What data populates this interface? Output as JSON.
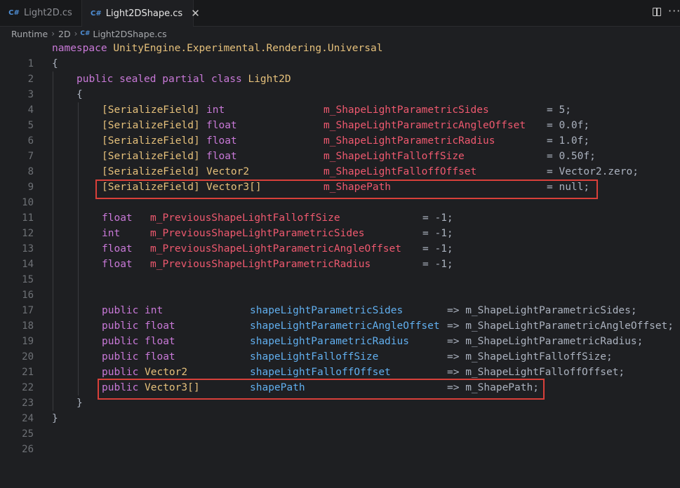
{
  "tabs": [
    {
      "label": "Light2D.cs",
      "icon": "csharp-file-icon",
      "active": false
    },
    {
      "label": "Light2DShape.cs",
      "icon": "csharp-file-icon",
      "active": true
    }
  ],
  "toolbar": {
    "split_icon": "split-editor-icon",
    "more_icon": "more-actions-icon",
    "more_label": "···",
    "close_label": "✕"
  },
  "breadcrumb": {
    "items": [
      "Runtime",
      "2D",
      "Light2DShape.cs"
    ],
    "separator": "›",
    "icon_label": "C#"
  },
  "colors": {
    "highlight_box": "#d8403a",
    "keyword": "#c979d8",
    "type": "#e5c07b",
    "field": "#ef596f",
    "property": "#61afef"
  },
  "code": {
    "lines": [
      {
        "n": "1"
      },
      {
        "n": "2"
      },
      {
        "n": "3"
      },
      {
        "n": "4"
      },
      {
        "n": "5"
      },
      {
        "n": "6"
      },
      {
        "n": "7"
      },
      {
        "n": "8"
      },
      {
        "n": "9"
      },
      {
        "n": "10"
      },
      {
        "n": "11"
      },
      {
        "n": "12"
      },
      {
        "n": "13"
      },
      {
        "n": "14"
      },
      {
        "n": "15"
      },
      {
        "n": "16"
      },
      {
        "n": "17"
      },
      {
        "n": "18"
      },
      {
        "n": "19"
      },
      {
        "n": "20"
      },
      {
        "n": "21"
      },
      {
        "n": "22"
      },
      {
        "n": "23"
      },
      {
        "n": "24"
      },
      {
        "n": "25"
      },
      {
        "n": "26"
      }
    ],
    "namespace_kw": "namespace",
    "namespace_name": "UnityEngine.Experimental.Rendering.Universal",
    "open_brace": "{",
    "close_brace": "}",
    "class_decl_kw": "public sealed partial class",
    "class_name": "Light2D",
    "attr": "[SerializeField]",
    "fields": [
      {
        "type": "int",
        "name": "m_ShapeLightParametricSides",
        "value": "= 5;"
      },
      {
        "type": "float",
        "name": "m_ShapeLightParametricAngleOffset",
        "value": "= 0.0f;"
      },
      {
        "type": "float",
        "name": "m_ShapeLightParametricRadius",
        "value": "= 1.0f;"
      },
      {
        "type": "float",
        "name": "m_ShapeLightFalloffSize",
        "value": "= 0.50f;"
      },
      {
        "type": "Vector2",
        "name": "m_ShapeLightFalloffOffset",
        "value": "= Vector2.zero;"
      },
      {
        "type": "Vector3[]",
        "name": "m_ShapePath",
        "value": "= null;"
      }
    ],
    "prev_fields": [
      {
        "type": "float",
        "name": "m_PreviousShapeLightFalloffSize",
        "value": "= -1;"
      },
      {
        "type": "int",
        "name": "m_PreviousShapeLightParametricSides",
        "value": "= -1;"
      },
      {
        "type": "float",
        "name": "m_PreviousShapeLightParametricAngleOffset",
        "value": "= -1;"
      },
      {
        "type": "float",
        "name": "m_PreviousShapeLightParametricRadius",
        "value": "= -1;"
      }
    ],
    "public_kw": "public",
    "props": [
      {
        "type": "int",
        "name": "shapeLightParametricSides",
        "value": "=> m_ShapeLightParametricSides;"
      },
      {
        "type": "float",
        "name": "shapeLightParametricAngleOffset",
        "value": "=> m_ShapeLightParametricAngleOffset;"
      },
      {
        "type": "float",
        "name": "shapeLightParametricRadius",
        "value": "=> m_ShapeLightParametricRadius;"
      },
      {
        "type": "float",
        "name": "shapeLightFalloffSize",
        "value": "=> m_ShapeLightFalloffSize;"
      },
      {
        "type": "Vector2",
        "name": "shapeLightFalloffOffset",
        "value": "=> m_ShapeLightFalloffOffset;"
      },
      {
        "type": "Vector3[]",
        "name": "shapePath",
        "value": "=> m_ShapePath;"
      }
    ]
  }
}
